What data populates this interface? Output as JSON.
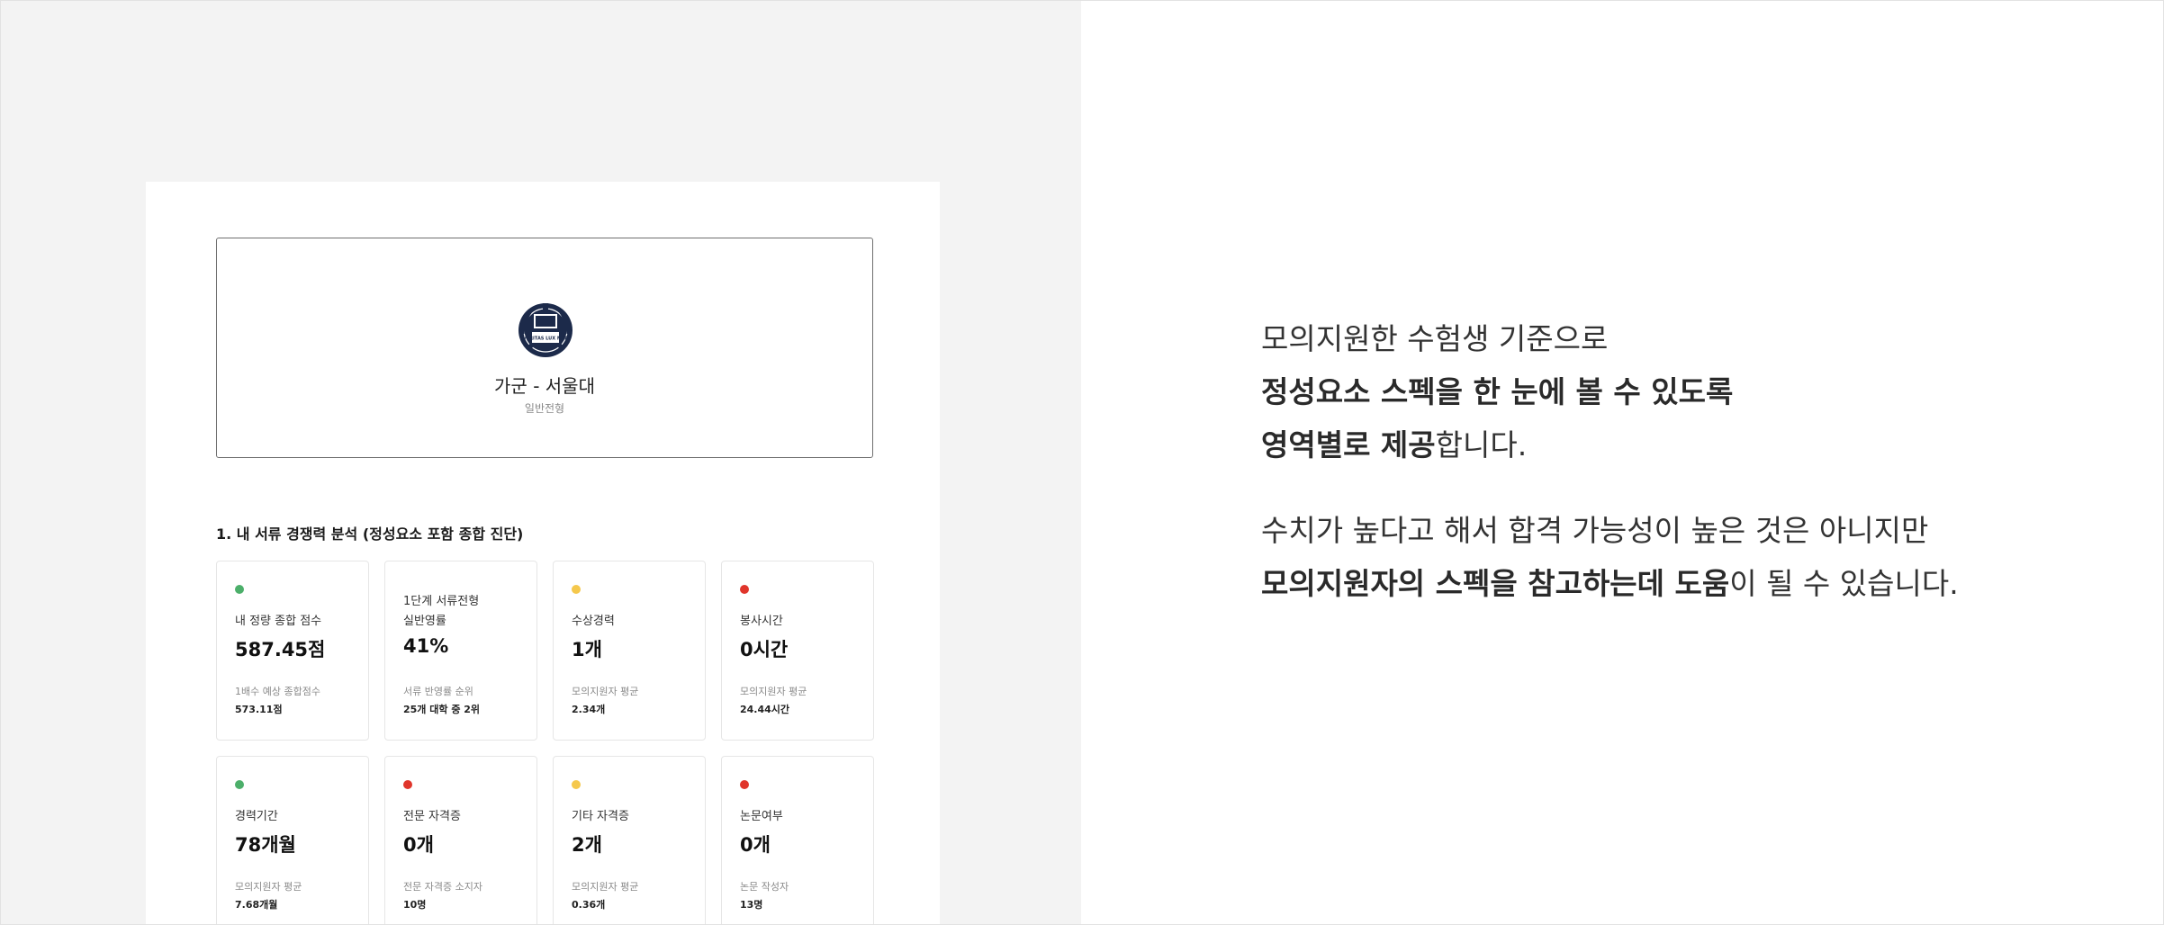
{
  "document": {
    "university": {
      "title": "가군 - 서울대",
      "subtitle": "일반전형",
      "emblem_icon": "snu-emblem-icon",
      "emblem_text": "VERITAS LUX MEA"
    },
    "section_title": "1. 내 서류 경쟁력 분석 (정성요소 포함 종합 진단)",
    "status_colors": {
      "green": "#4caf6a",
      "yellow": "#f5c84c",
      "red": "#e0352b"
    },
    "cards": [
      {
        "status": "green",
        "label": "내 정량 종합 점수",
        "value": "587.45점",
        "foot_label": "1배수 예상 종합점수",
        "foot_value": "573.11점"
      },
      {
        "status": "none",
        "label": "1단계 서류전형\n실반영률",
        "value": "41%",
        "foot_label": "서류 반영률 순위",
        "foot_value": "25개 대학 중 2위"
      },
      {
        "status": "yellow",
        "label": "수상경력",
        "value": "1개",
        "foot_label": "모의지원자 평균",
        "foot_value": "2.34개"
      },
      {
        "status": "red",
        "label": "봉사시간",
        "value": "0시간",
        "foot_label": "모의지원자 평균",
        "foot_value": "24.44시간"
      },
      {
        "status": "green",
        "label": "경력기간",
        "value": "78개월",
        "foot_label": "모의지원자 평균",
        "foot_value": "7.68개월"
      },
      {
        "status": "red",
        "label": "전문 자격증",
        "value": "0개",
        "foot_label": "전문 자격증 소지자",
        "foot_value": "10명"
      },
      {
        "status": "yellow",
        "label": "기타 자격증",
        "value": "2개",
        "foot_label": "모의지원자 평균",
        "foot_value": "0.36개"
      },
      {
        "status": "red",
        "label": "논문여부",
        "value": "0개",
        "foot_label": "논문 작성자",
        "foot_value": "13명"
      }
    ]
  },
  "copy": {
    "line1": "모의지원한 수험생 기준으로",
    "line2_bold": "정성요소 스펙을 한 눈에 볼 수 있도록",
    "line3_bold": "영역별로 제공",
    "line3_rest": "합니다.",
    "line4": "수치가 높다고 해서 합격 가능성이 높은 것은 아니지만",
    "line5_bold": "모의지원자의 스펙을 참고하는데 도움",
    "line5_rest": "이 될 수 있습니다."
  }
}
